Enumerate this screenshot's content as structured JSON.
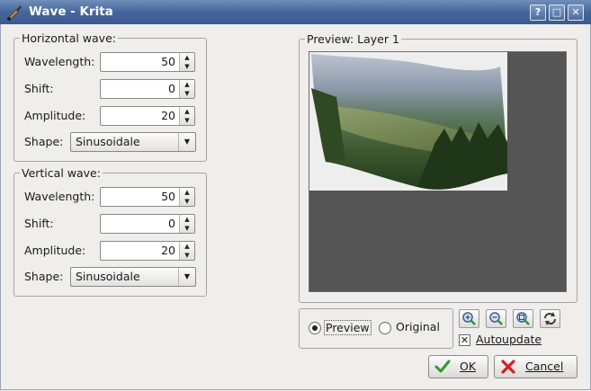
{
  "window": {
    "title": "Wave - Krita",
    "help_glyph": "?",
    "maximize_glyph": "□",
    "close_glyph": "✕"
  },
  "horizontal": {
    "title": "Horizontal wave:",
    "wavelength_label": "Wavelength:",
    "wavelength": "50",
    "shift_label": "Shift:",
    "shift": "0",
    "amplitude_label": "Amplitude:",
    "amplitude": "20",
    "shape_label": "Shape:",
    "shape": "Sinusoidale"
  },
  "vertical": {
    "title": "Vertical wave:",
    "wavelength_label": "Wavelength:",
    "wavelength": "50",
    "shift_label": "Shift:",
    "shift": "0",
    "amplitude_label": "Amplitude:",
    "amplitude": "20",
    "shape_label": "Shape:",
    "shape": "Sinusoidale"
  },
  "preview": {
    "title": "Preview: Layer 1",
    "mode_preview": "Preview",
    "mode_original": "Original",
    "selected_mode": "preview",
    "autoupdate_label": "Autoupdate",
    "autoupdate_checked": true,
    "zoom_icons": [
      "zoom-in-icon",
      "zoom-out-icon",
      "zoom-fit-icon",
      "refresh-icon"
    ]
  },
  "buttons": {
    "ok": "OK",
    "cancel": "Cancel"
  },
  "colors": {
    "titlebar": "#45669a",
    "ok_check": "#2e9b2e",
    "cancel_x": "#d42020",
    "preview_background": "#555555"
  }
}
